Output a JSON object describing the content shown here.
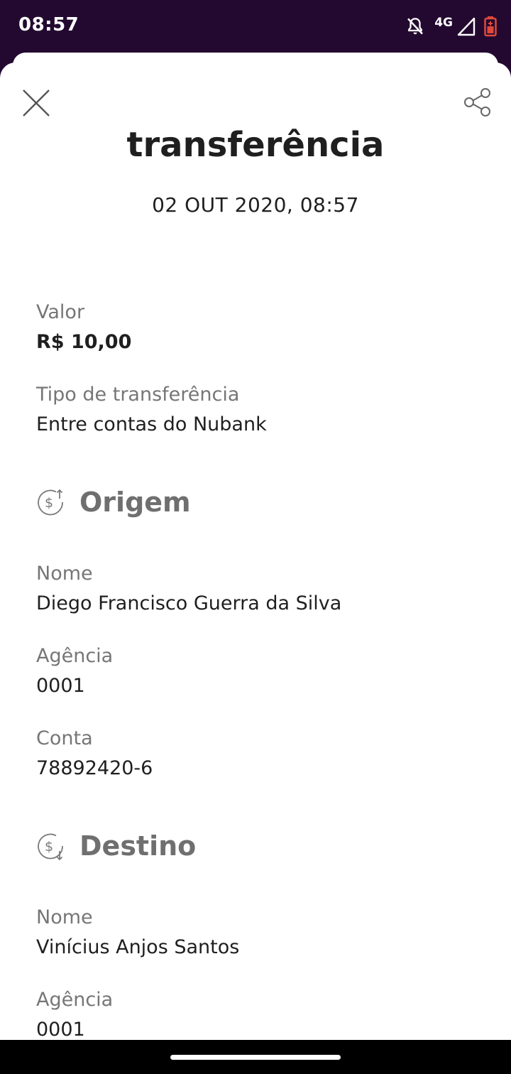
{
  "status_bar": {
    "time": "08:57",
    "network": "4G",
    "icons": [
      "notifications-off-icon",
      "signal-icon",
      "battery-icon"
    ],
    "battery_color": "#E0483A"
  },
  "header": {
    "close_icon": "close-icon",
    "share_icon": "share-icon",
    "title": "transferência",
    "date": "02 OUT 2020, 08:57"
  },
  "summary": {
    "value_label": "Valor",
    "value": "R$ 10,00",
    "type_label": "Tipo de transferência",
    "type_value": "Entre contas do Nubank"
  },
  "origin": {
    "icon": "money-out-icon",
    "title": "Origem",
    "name_label": "Nome",
    "name": "Diego Francisco Guerra da Silva",
    "agency_label": "Agência",
    "agency": "0001",
    "account_label": "Conta",
    "account": "78892420-6"
  },
  "destination": {
    "icon": "money-in-icon",
    "title": "Destino",
    "name_label": "Nome",
    "name": "Vinícius Anjos Santos",
    "agency_label": "Agência",
    "agency": "0001"
  },
  "colors": {
    "status_bar_bg": "#230930",
    "text_primary": "#1F1F1F",
    "text_secondary": "#767676"
  }
}
